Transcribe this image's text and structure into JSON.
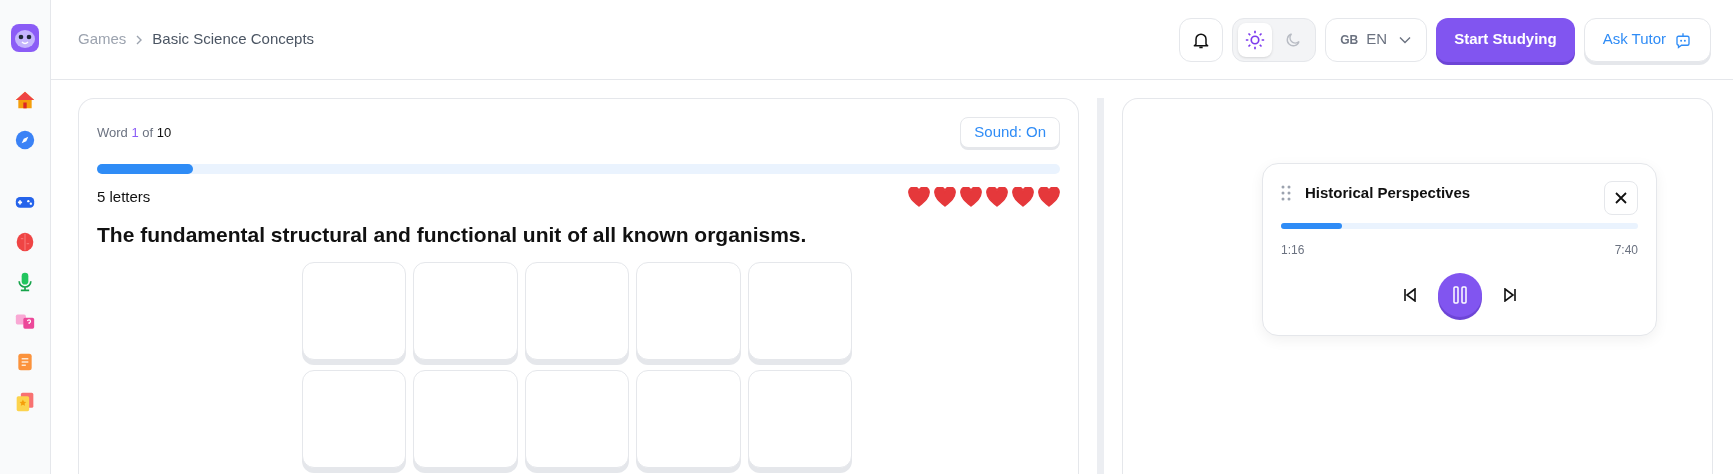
{
  "sidebar": {
    "items": [
      {
        "kind": "home"
      },
      {
        "kind": "compass"
      },
      {
        "kind": "gamepad"
      },
      {
        "kind": "brain"
      },
      {
        "kind": "microphone"
      },
      {
        "kind": "questions"
      },
      {
        "kind": "notes"
      },
      {
        "kind": "cards"
      }
    ]
  },
  "breadcrumb": [
    {
      "label": "Games"
    },
    {
      "label": "Basic Science Concepts"
    }
  ],
  "header": {
    "theme": [
      {
        "kind": "sun",
        "selected": true
      },
      {
        "kind": "moon",
        "selected": false
      }
    ],
    "language": {
      "flag": "GB",
      "code": "EN"
    },
    "primary_button": "Start Studying",
    "secondary_button": "Ask Tutor"
  },
  "game": {
    "counter_word": "Word",
    "counter_current": "1",
    "counter_of": "of",
    "counter_total": "10",
    "sound_button": "Sound: On",
    "progress": {
      "level": 0.1
    },
    "letters_label": "5 letters",
    "hearts": [
      {
        "filled": true
      },
      {
        "filled": true
      },
      {
        "filled": true
      },
      {
        "filled": true
      },
      {
        "filled": true
      },
      {
        "filled": true
      }
    ],
    "clue": "The fundamental structural and functional unit of all known organisms.",
    "tiles": [
      {
        "filled": false
      },
      {
        "filled": false
      },
      {
        "filled": false
      },
      {
        "filled": false
      },
      {
        "filled": false
      },
      {
        "filled": false
      },
      {
        "filled": false
      },
      {
        "filled": false
      },
      {
        "filled": false
      },
      {
        "filled": false
      }
    ]
  },
  "player": {
    "title": "Historical Perspectives",
    "progress": {
      "level": 0.17
    },
    "elapsed": "1:16",
    "duration": "7:40",
    "playing": true
  }
}
